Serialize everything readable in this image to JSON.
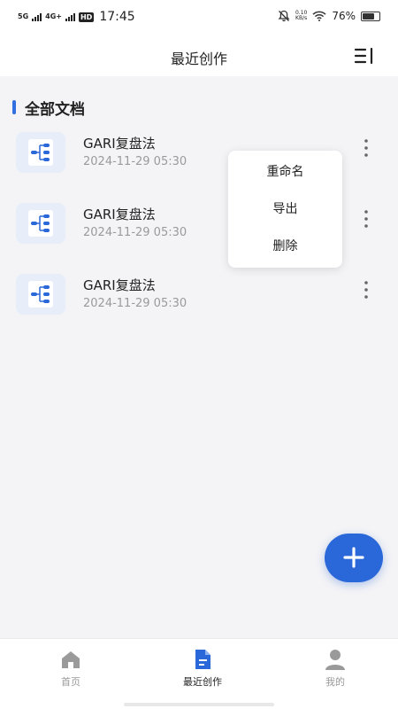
{
  "status_bar": {
    "network_1": "5G",
    "network_2": "4G+",
    "hd_badge": "HD",
    "time": "17:45",
    "speed_value": "0.10",
    "speed_unit": "KB/s",
    "battery_percent": "76%",
    "battery_level": 0.76
  },
  "header": {
    "title": "最近创作"
  },
  "section": {
    "title": "全部文档"
  },
  "documents": [
    {
      "name": "GARI复盘法",
      "date": "2024-11-29 05:30"
    },
    {
      "name": "GARI复盘法",
      "date": "2024-11-29 05:30"
    },
    {
      "name": "GARI复盘法",
      "date": "2024-11-29 05:30"
    }
  ],
  "context_menu": {
    "rename": "重命名",
    "export": "导出",
    "delete": "删除"
  },
  "tabs": [
    {
      "label": "首页",
      "active": false
    },
    {
      "label": "最近创作",
      "active": true
    },
    {
      "label": "我的",
      "active": false
    }
  ],
  "colors": {
    "accent": "#2a67d8",
    "tab_inactive": "#9a9a9a",
    "tab_active": "#222222"
  }
}
